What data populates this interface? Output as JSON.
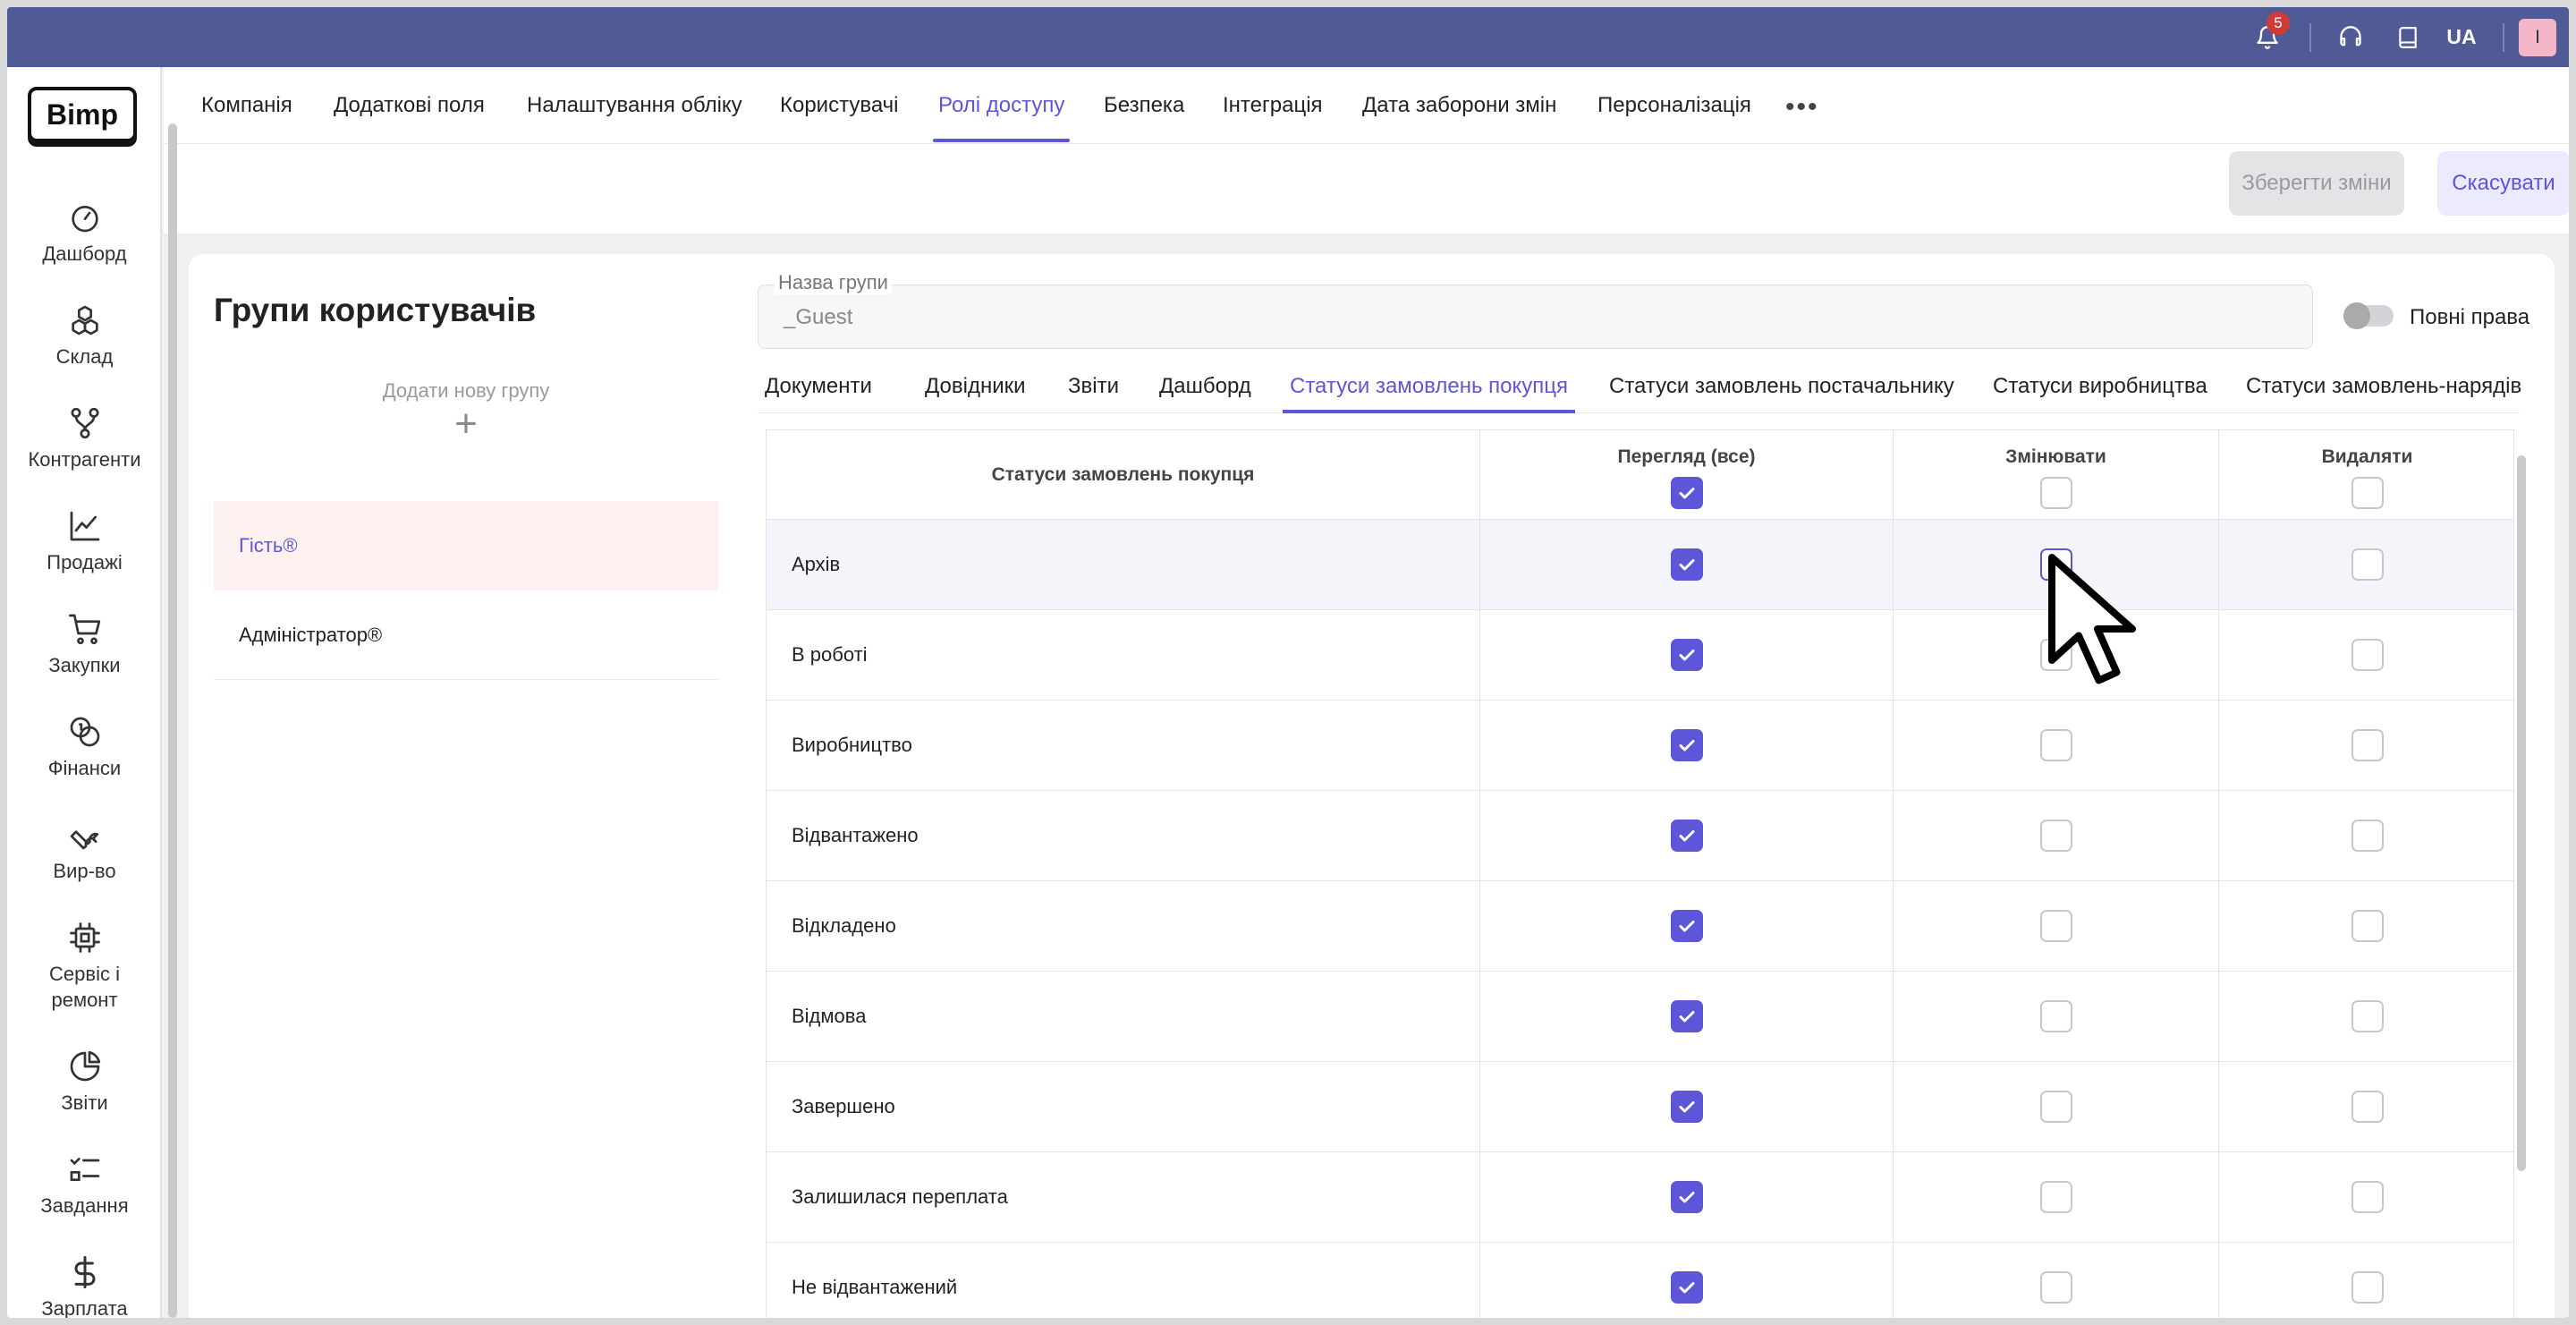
{
  "topbar": {
    "notifications_count": "5",
    "language": "UA",
    "user_initial": "I"
  },
  "sidebar": {
    "logo": "Bimp",
    "items": [
      {
        "label": "Дашборд",
        "icon": "speedometer-icon"
      },
      {
        "label": "Склад",
        "icon": "boxes-icon"
      },
      {
        "label": "Контрагенти",
        "icon": "network-icon"
      },
      {
        "label": "Продажі",
        "icon": "chart-line-icon"
      },
      {
        "label": "Закупки",
        "icon": "cart-icon"
      },
      {
        "label": "Фінанси",
        "icon": "coins-icon"
      },
      {
        "label": "Вир-во",
        "icon": "wrench-icon"
      },
      {
        "label": "Сервіс і ремонт",
        "icon": "chip-icon"
      },
      {
        "label": "Звіти",
        "icon": "pie-chart-icon"
      },
      {
        "label": "Завдання",
        "icon": "task-list-icon"
      },
      {
        "label": "Зарплата",
        "icon": "dollar-icon"
      }
    ]
  },
  "header": {
    "tabs": [
      {
        "label": "Компанія"
      },
      {
        "label": "Додаткові поля"
      },
      {
        "label": "Налаштування обліку"
      },
      {
        "label": "Користувачі"
      },
      {
        "label": "Ролі доступу",
        "active": true
      },
      {
        "label": "Безпека"
      },
      {
        "label": "Інтеграція"
      },
      {
        "label": "Дата заборони змін"
      },
      {
        "label": "Персоналізація"
      }
    ],
    "more_label": "•••",
    "save_label": "Зберегти зміни",
    "cancel_label": "Скасувати"
  },
  "groups": {
    "title": "Групи користувачів",
    "add_label": "Додати нову групу",
    "add_plus": "+",
    "items": [
      {
        "label": "Гість®",
        "active": true
      },
      {
        "label": "Адміністратор®"
      }
    ]
  },
  "group_form": {
    "name_label": "Назва групи",
    "name_value": "_Guest",
    "full_rights_label": "Повні права",
    "full_rights_on": false
  },
  "sub_tabs": [
    {
      "label": "Документи"
    },
    {
      "label": "Довідники"
    },
    {
      "label": "Звіти"
    },
    {
      "label": "Дашборд"
    },
    {
      "label": "Статуси замовлень покупця",
      "active": true
    },
    {
      "label": "Статуси замовлень постачальнику"
    },
    {
      "label": "Статуси виробництва"
    },
    {
      "label": "Статуси замовлень-нарядів"
    }
  ],
  "permissions_table": {
    "columns": [
      "Статуси замовлень покупця",
      "Перегляд (все)",
      "Змінювати",
      "Видаляти"
    ],
    "header_checks": {
      "view": true,
      "edit": false,
      "delete": false
    },
    "rows": [
      {
        "status": "Архів",
        "view": true,
        "edit": false,
        "delete": false
      },
      {
        "status": "В роботі",
        "view": true,
        "edit": false,
        "delete": false
      },
      {
        "status": "Виробництво",
        "view": true,
        "edit": false,
        "delete": false
      },
      {
        "status": "Відвантажено",
        "view": true,
        "edit": false,
        "delete": false
      },
      {
        "status": "Відкладено",
        "view": true,
        "edit": false,
        "delete": false
      },
      {
        "status": "Відмова",
        "view": true,
        "edit": false,
        "delete": false
      },
      {
        "status": "Завершено",
        "view": true,
        "edit": false,
        "delete": false
      },
      {
        "status": "Залишилася переплата",
        "view": true,
        "edit": false,
        "delete": false
      },
      {
        "status": "Не відвантажений",
        "view": true,
        "edit": false,
        "delete": false
      }
    ]
  },
  "colors": {
    "accent": "#5d56d8",
    "topbar": "#505b95",
    "selected_group_bg": "#fcf1ef"
  }
}
